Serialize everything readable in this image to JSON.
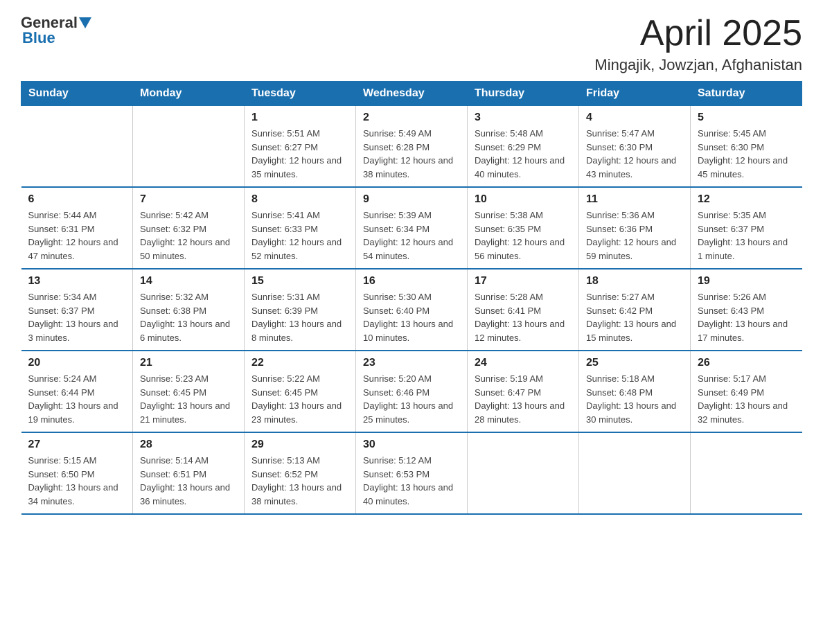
{
  "logo": {
    "general": "General",
    "blue": "Blue"
  },
  "title": "April 2025",
  "location": "Mingajik, Jowzjan, Afghanistan",
  "headers": [
    "Sunday",
    "Monday",
    "Tuesday",
    "Wednesday",
    "Thursday",
    "Friday",
    "Saturday"
  ],
  "weeks": [
    [
      {
        "day": "",
        "sunrise": "",
        "sunset": "",
        "daylight": ""
      },
      {
        "day": "",
        "sunrise": "",
        "sunset": "",
        "daylight": ""
      },
      {
        "day": "1",
        "sunrise": "Sunrise: 5:51 AM",
        "sunset": "Sunset: 6:27 PM",
        "daylight": "Daylight: 12 hours and 35 minutes."
      },
      {
        "day": "2",
        "sunrise": "Sunrise: 5:49 AM",
        "sunset": "Sunset: 6:28 PM",
        "daylight": "Daylight: 12 hours and 38 minutes."
      },
      {
        "day": "3",
        "sunrise": "Sunrise: 5:48 AM",
        "sunset": "Sunset: 6:29 PM",
        "daylight": "Daylight: 12 hours and 40 minutes."
      },
      {
        "day": "4",
        "sunrise": "Sunrise: 5:47 AM",
        "sunset": "Sunset: 6:30 PM",
        "daylight": "Daylight: 12 hours and 43 minutes."
      },
      {
        "day": "5",
        "sunrise": "Sunrise: 5:45 AM",
        "sunset": "Sunset: 6:30 PM",
        "daylight": "Daylight: 12 hours and 45 minutes."
      }
    ],
    [
      {
        "day": "6",
        "sunrise": "Sunrise: 5:44 AM",
        "sunset": "Sunset: 6:31 PM",
        "daylight": "Daylight: 12 hours and 47 minutes."
      },
      {
        "day": "7",
        "sunrise": "Sunrise: 5:42 AM",
        "sunset": "Sunset: 6:32 PM",
        "daylight": "Daylight: 12 hours and 50 minutes."
      },
      {
        "day": "8",
        "sunrise": "Sunrise: 5:41 AM",
        "sunset": "Sunset: 6:33 PM",
        "daylight": "Daylight: 12 hours and 52 minutes."
      },
      {
        "day": "9",
        "sunrise": "Sunrise: 5:39 AM",
        "sunset": "Sunset: 6:34 PM",
        "daylight": "Daylight: 12 hours and 54 minutes."
      },
      {
        "day": "10",
        "sunrise": "Sunrise: 5:38 AM",
        "sunset": "Sunset: 6:35 PM",
        "daylight": "Daylight: 12 hours and 56 minutes."
      },
      {
        "day": "11",
        "sunrise": "Sunrise: 5:36 AM",
        "sunset": "Sunset: 6:36 PM",
        "daylight": "Daylight: 12 hours and 59 minutes."
      },
      {
        "day": "12",
        "sunrise": "Sunrise: 5:35 AM",
        "sunset": "Sunset: 6:37 PM",
        "daylight": "Daylight: 13 hours and 1 minute."
      }
    ],
    [
      {
        "day": "13",
        "sunrise": "Sunrise: 5:34 AM",
        "sunset": "Sunset: 6:37 PM",
        "daylight": "Daylight: 13 hours and 3 minutes."
      },
      {
        "day": "14",
        "sunrise": "Sunrise: 5:32 AM",
        "sunset": "Sunset: 6:38 PM",
        "daylight": "Daylight: 13 hours and 6 minutes."
      },
      {
        "day": "15",
        "sunrise": "Sunrise: 5:31 AM",
        "sunset": "Sunset: 6:39 PM",
        "daylight": "Daylight: 13 hours and 8 minutes."
      },
      {
        "day": "16",
        "sunrise": "Sunrise: 5:30 AM",
        "sunset": "Sunset: 6:40 PM",
        "daylight": "Daylight: 13 hours and 10 minutes."
      },
      {
        "day": "17",
        "sunrise": "Sunrise: 5:28 AM",
        "sunset": "Sunset: 6:41 PM",
        "daylight": "Daylight: 13 hours and 12 minutes."
      },
      {
        "day": "18",
        "sunrise": "Sunrise: 5:27 AM",
        "sunset": "Sunset: 6:42 PM",
        "daylight": "Daylight: 13 hours and 15 minutes."
      },
      {
        "day": "19",
        "sunrise": "Sunrise: 5:26 AM",
        "sunset": "Sunset: 6:43 PM",
        "daylight": "Daylight: 13 hours and 17 minutes."
      }
    ],
    [
      {
        "day": "20",
        "sunrise": "Sunrise: 5:24 AM",
        "sunset": "Sunset: 6:44 PM",
        "daylight": "Daylight: 13 hours and 19 minutes."
      },
      {
        "day": "21",
        "sunrise": "Sunrise: 5:23 AM",
        "sunset": "Sunset: 6:45 PM",
        "daylight": "Daylight: 13 hours and 21 minutes."
      },
      {
        "day": "22",
        "sunrise": "Sunrise: 5:22 AM",
        "sunset": "Sunset: 6:45 PM",
        "daylight": "Daylight: 13 hours and 23 minutes."
      },
      {
        "day": "23",
        "sunrise": "Sunrise: 5:20 AM",
        "sunset": "Sunset: 6:46 PM",
        "daylight": "Daylight: 13 hours and 25 minutes."
      },
      {
        "day": "24",
        "sunrise": "Sunrise: 5:19 AM",
        "sunset": "Sunset: 6:47 PM",
        "daylight": "Daylight: 13 hours and 28 minutes."
      },
      {
        "day": "25",
        "sunrise": "Sunrise: 5:18 AM",
        "sunset": "Sunset: 6:48 PM",
        "daylight": "Daylight: 13 hours and 30 minutes."
      },
      {
        "day": "26",
        "sunrise": "Sunrise: 5:17 AM",
        "sunset": "Sunset: 6:49 PM",
        "daylight": "Daylight: 13 hours and 32 minutes."
      }
    ],
    [
      {
        "day": "27",
        "sunrise": "Sunrise: 5:15 AM",
        "sunset": "Sunset: 6:50 PM",
        "daylight": "Daylight: 13 hours and 34 minutes."
      },
      {
        "day": "28",
        "sunrise": "Sunrise: 5:14 AM",
        "sunset": "Sunset: 6:51 PM",
        "daylight": "Daylight: 13 hours and 36 minutes."
      },
      {
        "day": "29",
        "sunrise": "Sunrise: 5:13 AM",
        "sunset": "Sunset: 6:52 PM",
        "daylight": "Daylight: 13 hours and 38 minutes."
      },
      {
        "day": "30",
        "sunrise": "Sunrise: 5:12 AM",
        "sunset": "Sunset: 6:53 PM",
        "daylight": "Daylight: 13 hours and 40 minutes."
      },
      {
        "day": "",
        "sunrise": "",
        "sunset": "",
        "daylight": ""
      },
      {
        "day": "",
        "sunrise": "",
        "sunset": "",
        "daylight": ""
      },
      {
        "day": "",
        "sunrise": "",
        "sunset": "",
        "daylight": ""
      }
    ]
  ]
}
